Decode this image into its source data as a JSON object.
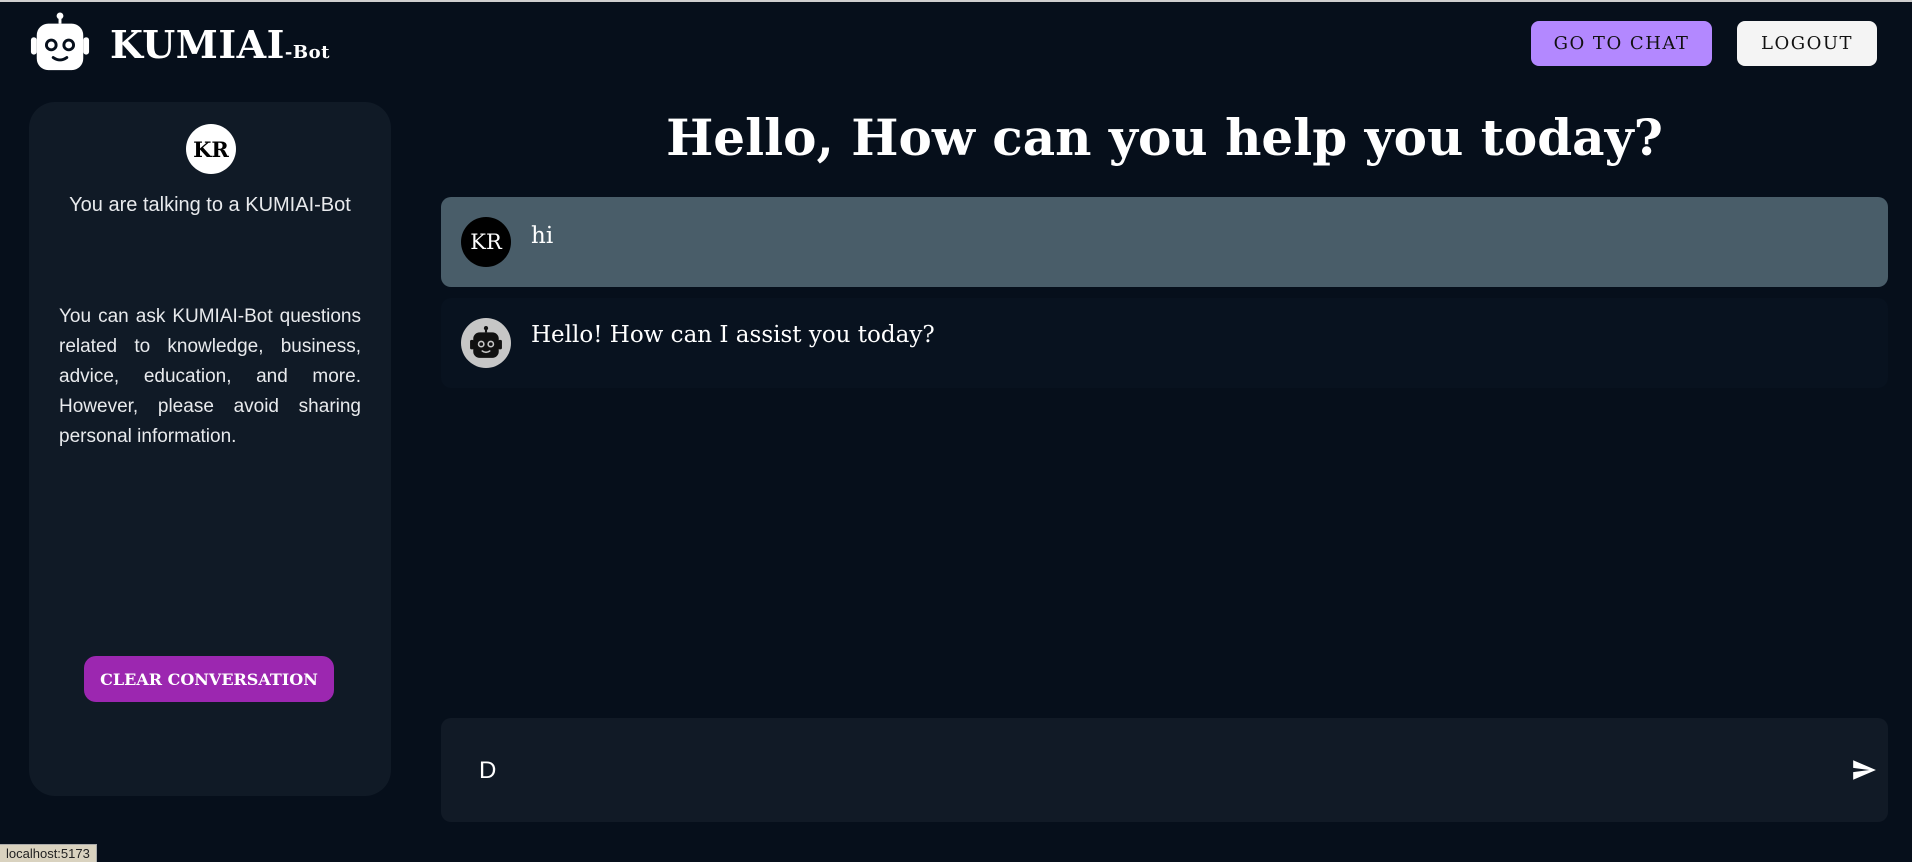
{
  "header": {
    "brand_main": "KUMIAI",
    "brand_suffix": "-Bot",
    "go_to_chat_label": "GO TO CHAT",
    "logout_label": "LOGOUT",
    "logo_icon": "robot-icon"
  },
  "sidebar": {
    "avatar_initials": "KR",
    "title": "You are talking to a KUMIAI-Bot",
    "description": "You can ask KUMIAI-Bot questions related to knowledge, business, advice, education, and more. However, please avoid sharing personal information.",
    "clear_label": "CLEAR CONVERSATION"
  },
  "main": {
    "greeting": "Hello, How can you help you today?",
    "messages": [
      {
        "role": "user",
        "avatar": "KR",
        "text": "hi"
      },
      {
        "role": "bot",
        "avatar": "robot-icon",
        "text": "Hello! How can I assist you today?"
      }
    ],
    "input_value": "D",
    "send_icon": "send-icon"
  },
  "status_bar": {
    "url": "localhost:5173"
  },
  "colors": {
    "background": "#060f1b",
    "panel": "#101a26",
    "accent_purple": "#b388ff",
    "clear_button": "#9c27b0",
    "user_message_bg": "#495d69"
  }
}
